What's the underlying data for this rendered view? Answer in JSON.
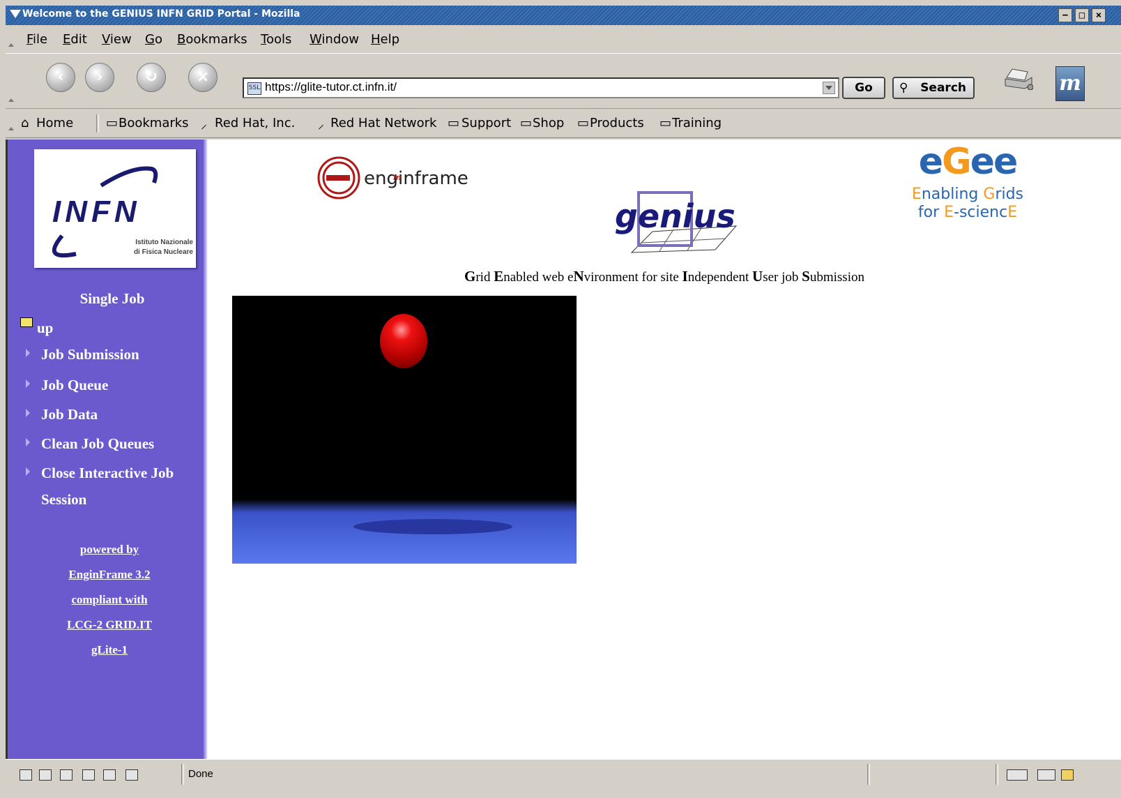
{
  "window": {
    "title": "Welcome to the GENIUS INFN GRID Portal - Mozilla"
  },
  "menu": {
    "items": [
      "File",
      "Edit",
      "View",
      "Go",
      "Bookmarks",
      "Tools",
      "Window",
      "Help"
    ]
  },
  "navigation": {
    "url": "https://glite-tutor.ct.infn.it/",
    "go_label": "Go",
    "search_label": "Search",
    "throbber_text": "m",
    "site_icon_text": "SSL"
  },
  "personal_toolbar": {
    "items": [
      "Home",
      "Bookmarks",
      "Red Hat, Inc.",
      "Red Hat Network",
      "Support",
      "Shop",
      "Products",
      "Training"
    ]
  },
  "sidebar": {
    "logo_text": "INFN",
    "logo_subtitle_1": "Istituto Nazionale",
    "logo_subtitle_2": "di Fisica Nucleare",
    "heading": "Single Job",
    "up_label": "up",
    "links": [
      "Job Submission",
      "Job Queue",
      "Job Data",
      "Clean Job Queues",
      "Close Interactive Job"
    ],
    "link_continuation": "Session",
    "powered": [
      "powered by",
      "EnginFrame 3.2",
      "compliant with",
      "LCG-2 GRID.IT",
      "gLite-1"
    ]
  },
  "page": {
    "enginframe_logo": "enginframe",
    "enginframe_in": "in",
    "genius_logo": "genius",
    "egee_logo": "eGee",
    "egee_line1_a": "E",
    "egee_line1_b": "nabling ",
    "egee_line1_c": "G",
    "egee_line1_d": "rids",
    "egee_line2_a": "for ",
    "egee_line2_b": "E",
    "egee_line2_c": "-scienc",
    "egee_line2_d": "E",
    "tagline_parts": [
      "G",
      "rid ",
      "E",
      "nabled web e",
      "N",
      "vironment for site ",
      "I",
      "ndependent ",
      "U",
      "ser job ",
      "S",
      "ubmission"
    ]
  },
  "status": {
    "text": "Done"
  },
  "colors": {
    "sidebar": "#6a5acd",
    "title_bar": "#2a5d9c",
    "egee_orange": "#f39a1e",
    "egee_blue": "#2a65b0",
    "genius_navy": "#1a1a7a"
  }
}
